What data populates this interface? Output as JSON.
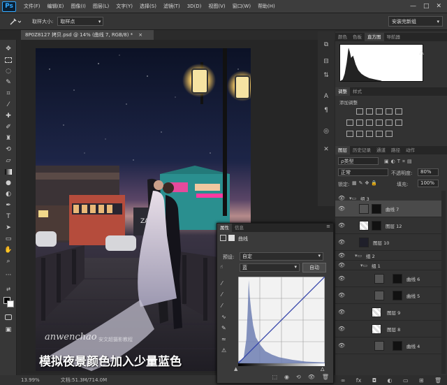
{
  "menubar": {
    "logo": "Ps",
    "items": [
      "文件(F)",
      "编辑(E)",
      "图像(I)",
      "图层(L)",
      "文字(Y)",
      "选择(S)",
      "滤镜(T)",
      "3D(D)",
      "视图(V)",
      "窗口(W)",
      "帮助(H)"
    ],
    "win_controls": [
      "—",
      "□",
      "✕"
    ]
  },
  "options": {
    "sample_size_label": "取样大小:",
    "sample_size_value": "取样点",
    "workspace": "安装完新组"
  },
  "document": {
    "tab": "8P0Z8127 拷贝.psd @ 14% (曲线 7, RGB/8) *",
    "close": "×",
    "zoom": "13.99%",
    "doc_size": "文档:51.3M/714.0M"
  },
  "image": {
    "caption": "模拟夜景颜色加入少量蓝色",
    "watermark": "anwenchao",
    "watermark_sub": "安文超摄影教程",
    "sign": "ZAK"
  },
  "panel_top": {
    "tabs": [
      "颜色",
      "色板",
      "直方图",
      "导航器"
    ],
    "active": 2
  },
  "adjustments": {
    "tabs": [
      "调整",
      "样式"
    ],
    "title": "添加调整"
  },
  "layers_panel": {
    "tabs": [
      "图层",
      "历史记录",
      "通道",
      "路径",
      "动作"
    ],
    "filter_label": "ρ类型",
    "blend_mode": "正常",
    "opacity_label": "不透明度:",
    "opacity": "80%",
    "lock_label": "锁定:",
    "fill_label": "填充:",
    "fill": "100%",
    "layers": [
      {
        "name": "组 3",
        "type": "group",
        "indent": 0
      },
      {
        "name": "曲线 7",
        "type": "adj",
        "indent": 1,
        "selected": true
      },
      {
        "name": "图层 12",
        "type": "pixel",
        "indent": 1
      },
      {
        "name": "图层 10",
        "type": "pixel",
        "indent": 1
      },
      {
        "name": "组 2",
        "type": "group",
        "indent": 0
      },
      {
        "name": "组 1",
        "type": "group",
        "indent": 1
      },
      {
        "name": "曲线 6",
        "type": "adj",
        "indent": 2
      },
      {
        "name": "曲线 5",
        "type": "adj",
        "indent": 2
      },
      {
        "name": "图层 9",
        "type": "pixel",
        "indent": 2
      },
      {
        "name": "图层 8",
        "type": "pixel",
        "indent": 2
      },
      {
        "name": "曲线 4",
        "type": "adj",
        "indent": 2
      }
    ]
  },
  "properties": {
    "tabs": [
      "属性",
      "信息"
    ],
    "type_label": "曲线",
    "preset_label": "预设:",
    "preset": "自定",
    "channel": "蓝",
    "auto": "自动",
    "chart_data": {
      "type": "area",
      "title": "",
      "x": [
        0,
        16,
        24,
        28,
        31,
        34,
        38,
        44,
        52,
        64,
        80,
        100,
        120,
        160,
        200,
        255
      ],
      "values": [
        2,
        6,
        28,
        60,
        96,
        78,
        62,
        44,
        30,
        22,
        14,
        10,
        7,
        4,
        2,
        1
      ],
      "xlim": [
        0,
        255
      ],
      "ylim": [
        0,
        100
      ],
      "curve": [
        [
          0,
          0
        ],
        [
          255,
          255
        ]
      ]
    }
  },
  "histogram": {
    "x": [
      0,
      8,
      14,
      20,
      26,
      30,
      34,
      40,
      48,
      56,
      66,
      76,
      90,
      110,
      128
    ],
    "values": [
      0,
      4,
      20,
      50,
      92,
      80,
      64,
      70,
      46,
      30,
      20,
      14,
      8,
      4,
      1
    ]
  }
}
